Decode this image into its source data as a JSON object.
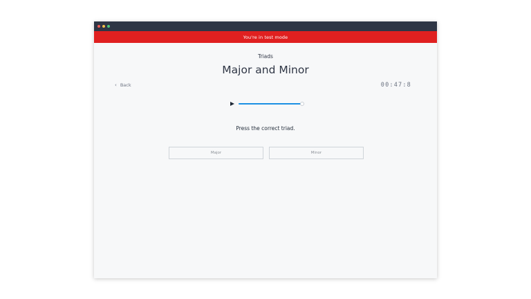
{
  "window": {
    "banner_text": "You're in test mode"
  },
  "header": {
    "category": "Triads",
    "title": "Major and Minor",
    "back_label": "Back",
    "timer": "00:47:8"
  },
  "player": {
    "progress": 0.98
  },
  "question": {
    "prompt": "Press the correct triad."
  },
  "answers": [
    {
      "label": "Major"
    },
    {
      "label": "Minor"
    }
  ],
  "colors": {
    "banner": "#e02020",
    "titlebar": "#2f3645",
    "accent": "#1a8fe3"
  }
}
